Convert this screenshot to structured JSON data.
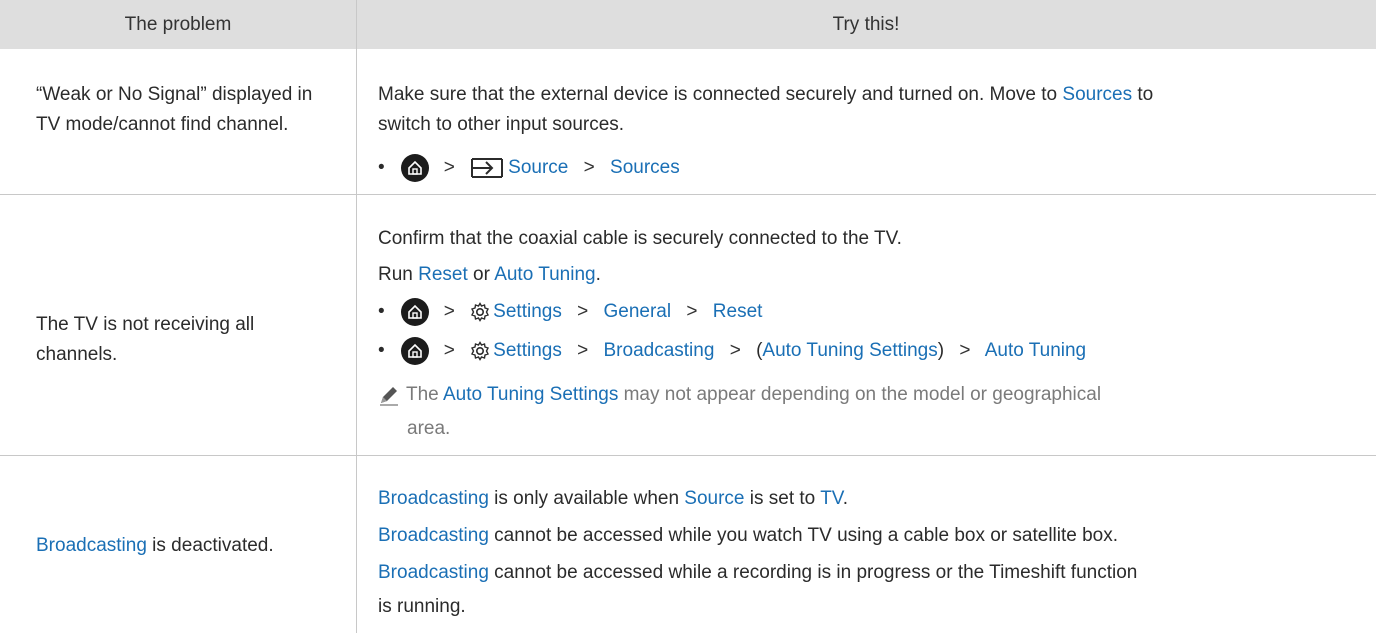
{
  "header": {
    "col1": "The problem",
    "col2": "Try this!"
  },
  "rows": [
    {
      "problem": "“Weak or No Signal” displayed in TV mode/cannot find channel.",
      "text1a": "Make sure that the external device is connected securely and turned on. Move to ",
      "text1b": "Sources",
      "text1c": " to",
      "text2": "switch to other input sources.",
      "path": [
        "Source",
        "Sources"
      ]
    },
    {
      "problem": "The TV is not receiving all channels.",
      "text1": "Confirm that the coaxial cable is securely connected to the TV.",
      "run_prefix": "Run ",
      "run_reset": "Reset",
      "run_or": " or ",
      "run_auto": "Auto Tuning",
      "run_dot": ".",
      "path1": [
        "Settings",
        "General",
        "Reset"
      ],
      "path2": [
        "Settings",
        "Broadcasting",
        "(",
        "Auto Tuning Settings",
        ")",
        "Auto Tuning"
      ],
      "note_prefix": "The ",
      "note_link": "Auto Tuning Settings",
      "note_rest": " may not appear depending on the model or geographical",
      "note_line2": "area."
    },
    {
      "problem_link": "Broadcasting",
      "problem_rest": " is deactivated.",
      "l1_a": "Broadcasting",
      "l1_b": " is only available when ",
      "l1_c": "Source",
      "l1_d": " is set to ",
      "l1_e": "TV",
      "l1_f": ".",
      "l2_a": "Broadcasting",
      "l2_b": " cannot be accessed while you watch TV using a cable box or satellite box.",
      "l3_a": "Broadcasting",
      "l3_b": " cannot be accessed while a recording is in progress or the Timeshift function",
      "l4": "is running."
    }
  ]
}
